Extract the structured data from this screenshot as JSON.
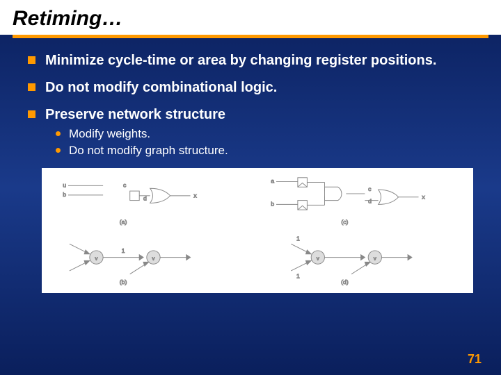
{
  "title": "Retiming…",
  "bullets": [
    {
      "text": "Minimize cycle-time or area by changing register positions."
    },
    {
      "text": "Do not modify combinational logic."
    },
    {
      "text": "Preserve network structure",
      "subs": [
        "Modify weights.",
        "Do not modify graph structure."
      ]
    }
  ],
  "diagram": {
    "labels": {
      "a": "a",
      "b": "b",
      "c": "c",
      "d": "d",
      "u": "u",
      "x": "x",
      "vc": "v",
      "vx": "v",
      "one": "1",
      "panelA": "(a)",
      "panelB": "(b)",
      "panelC": "(c)",
      "panelD": "(d)"
    }
  },
  "pageNumber": "71"
}
